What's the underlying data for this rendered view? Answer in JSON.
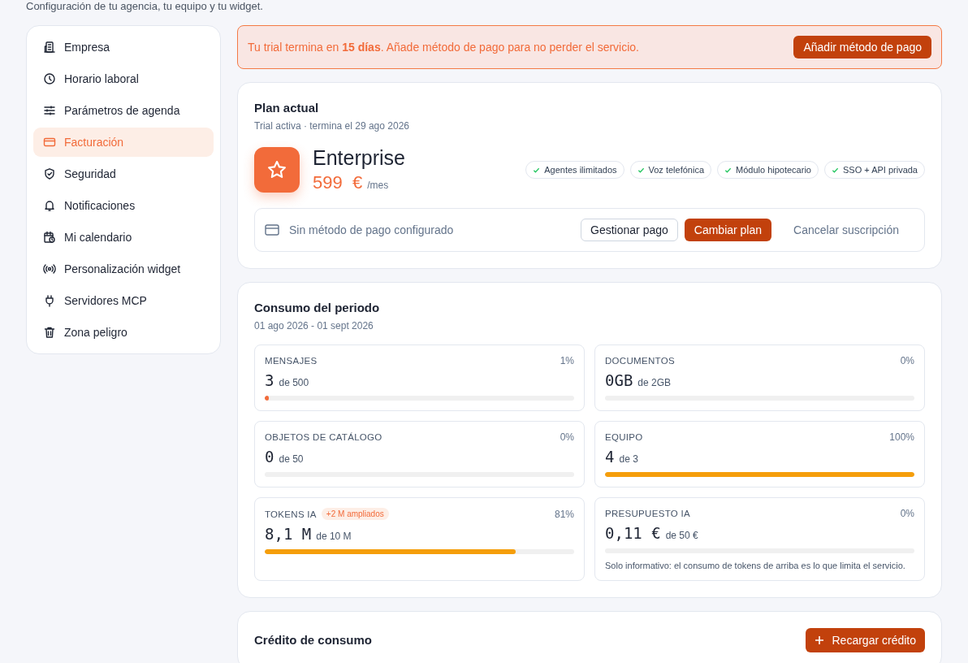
{
  "header": {
    "subtitle": "Configuración de tu agencia, tu equipo y tu widget."
  },
  "sidebar": {
    "items": [
      {
        "label": "Empresa",
        "selected": false
      },
      {
        "label": "Horario laboral",
        "selected": false
      },
      {
        "label": "Parámetros de agenda",
        "selected": false
      },
      {
        "label": "Facturación",
        "selected": true
      },
      {
        "label": "Seguridad",
        "selected": false
      },
      {
        "label": "Notificaciones",
        "selected": false
      },
      {
        "label": "Mi calendario",
        "selected": false
      },
      {
        "label": "Personalización widget",
        "selected": false
      },
      {
        "label": "Servidores MCP",
        "selected": false
      },
      {
        "label": "Zona peligro",
        "selected": false
      }
    ]
  },
  "trial_banner": {
    "message": "Tu trial termina en **15 días**. Añade método de pago para no perder el servicio.",
    "button": "Añadir método de pago"
  },
  "plan": {
    "title": "Plan actual",
    "subtitle": "Trial activa · termina el 29 ago 2026",
    "name": "Enterprise",
    "price": "599  €",
    "period": "/mes",
    "features": [
      "Agentes ilimitados",
      "Voz telefónica",
      "Módulo hipotecario",
      "SSO + API privada"
    ],
    "payment_status": "Sin método de pago configurado",
    "buttons": {
      "manage": "Gestionar pago",
      "change": "Cambiar plan",
      "cancel": "Cancelar suscripción"
    }
  },
  "usage": {
    "title": "Consumo del periodo",
    "range": "01 ago 2026 - 01 sept 2026",
    "meters": [
      {
        "label": "MENSAJES",
        "percent": "1%",
        "value": "3",
        "limit": "de 500",
        "level": 0.01,
        "color": "#f26b3a"
      },
      {
        "label": "DOCUMENTOS",
        "percent": "0%",
        "value": "0GB",
        "limit": "de 2GB"
      },
      {
        "label": "OBJETOS DE CATÁLOGO",
        "percent": "0%",
        "value": "0",
        "limit": "de 50"
      },
      {
        "label": "EQUIPO",
        "percent": "100%",
        "value": "4",
        "limit": "de 3",
        "level": 1,
        "color": "#f59e0b"
      },
      {
        "label": "TOKENS IA",
        "badge": "+2 M ampliados",
        "percent": "81%",
        "value": "8,1 M",
        "limit": "de 10 M",
        "level": 0.81,
        "color": "#f59e0b"
      },
      {
        "label": "PRESUPUESTO IA",
        "percent": "0%",
        "value": "0,11 €",
        "limit": "de 50 €",
        "note": "Solo informativo: el consumo de tokens de arriba es lo que limita el servicio."
      }
    ]
  },
  "credit": {
    "title": "Crédito de consumo",
    "button": "Recargar crédito"
  }
}
